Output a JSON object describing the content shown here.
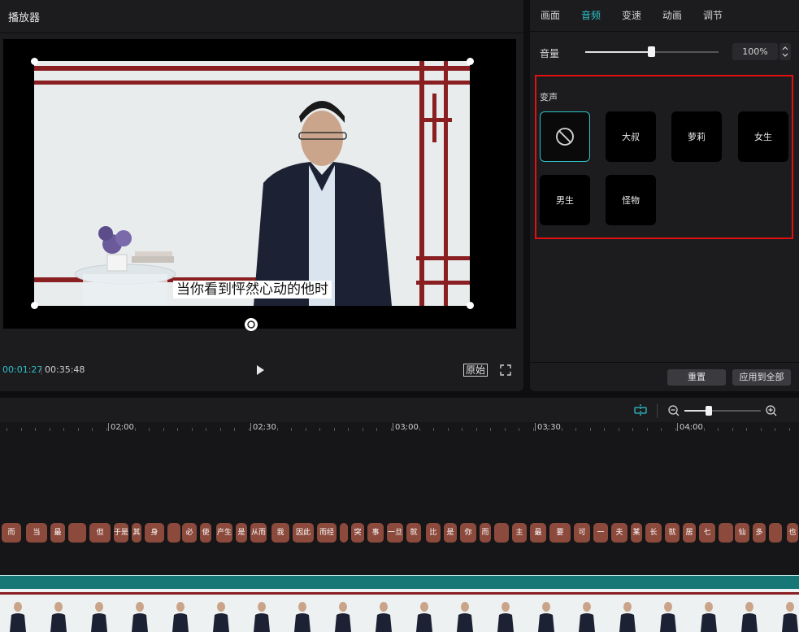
{
  "player": {
    "title": "播放器",
    "subtitle": "当你看到怦然心动的他时",
    "time_current": "00:01:27",
    "time_total": "00:35:48",
    "ratio_label": "原始"
  },
  "panel": {
    "tabs": [
      {
        "label": "画面",
        "active": false
      },
      {
        "label": "音频",
        "active": true
      },
      {
        "label": "变速",
        "active": false
      },
      {
        "label": "动画",
        "active": false
      },
      {
        "label": "调节",
        "active": false
      }
    ],
    "volume_label": "音量",
    "volume_value": "100%",
    "volume_fraction": 0.5,
    "voice_section_label": "变声",
    "voice_options": [
      {
        "label": "",
        "icon": "no-effect-icon",
        "selected": true
      },
      {
        "label": "大叔",
        "selected": false
      },
      {
        "label": "萝莉",
        "selected": false
      },
      {
        "label": "女生",
        "selected": false
      },
      {
        "label": "男生",
        "selected": false
      },
      {
        "label": "怪物",
        "selected": false
      }
    ],
    "reset_label": "重置",
    "apply_all_label": "应用到全部"
  },
  "timeline": {
    "ruler": [
      "02:00",
      "02:30",
      "03:00",
      "03:30",
      "04:00"
    ],
    "captions": [
      "而",
      "当",
      "最",
      "但",
      "于是",
      "其",
      "身",
      "必",
      "使",
      "产生",
      "是",
      "从而",
      "我",
      "因此",
      "而经",
      "突",
      "事",
      "一旦",
      "就",
      "比",
      "是",
      "你",
      "而",
      "主",
      "最",
      "要",
      "可",
      "一",
      "夫",
      "某",
      "长",
      "就",
      "居",
      "七",
      "仙",
      "多",
      "也"
    ],
    "accent_color": "#2fc1c8",
    "highlight_color": "#e01010"
  }
}
